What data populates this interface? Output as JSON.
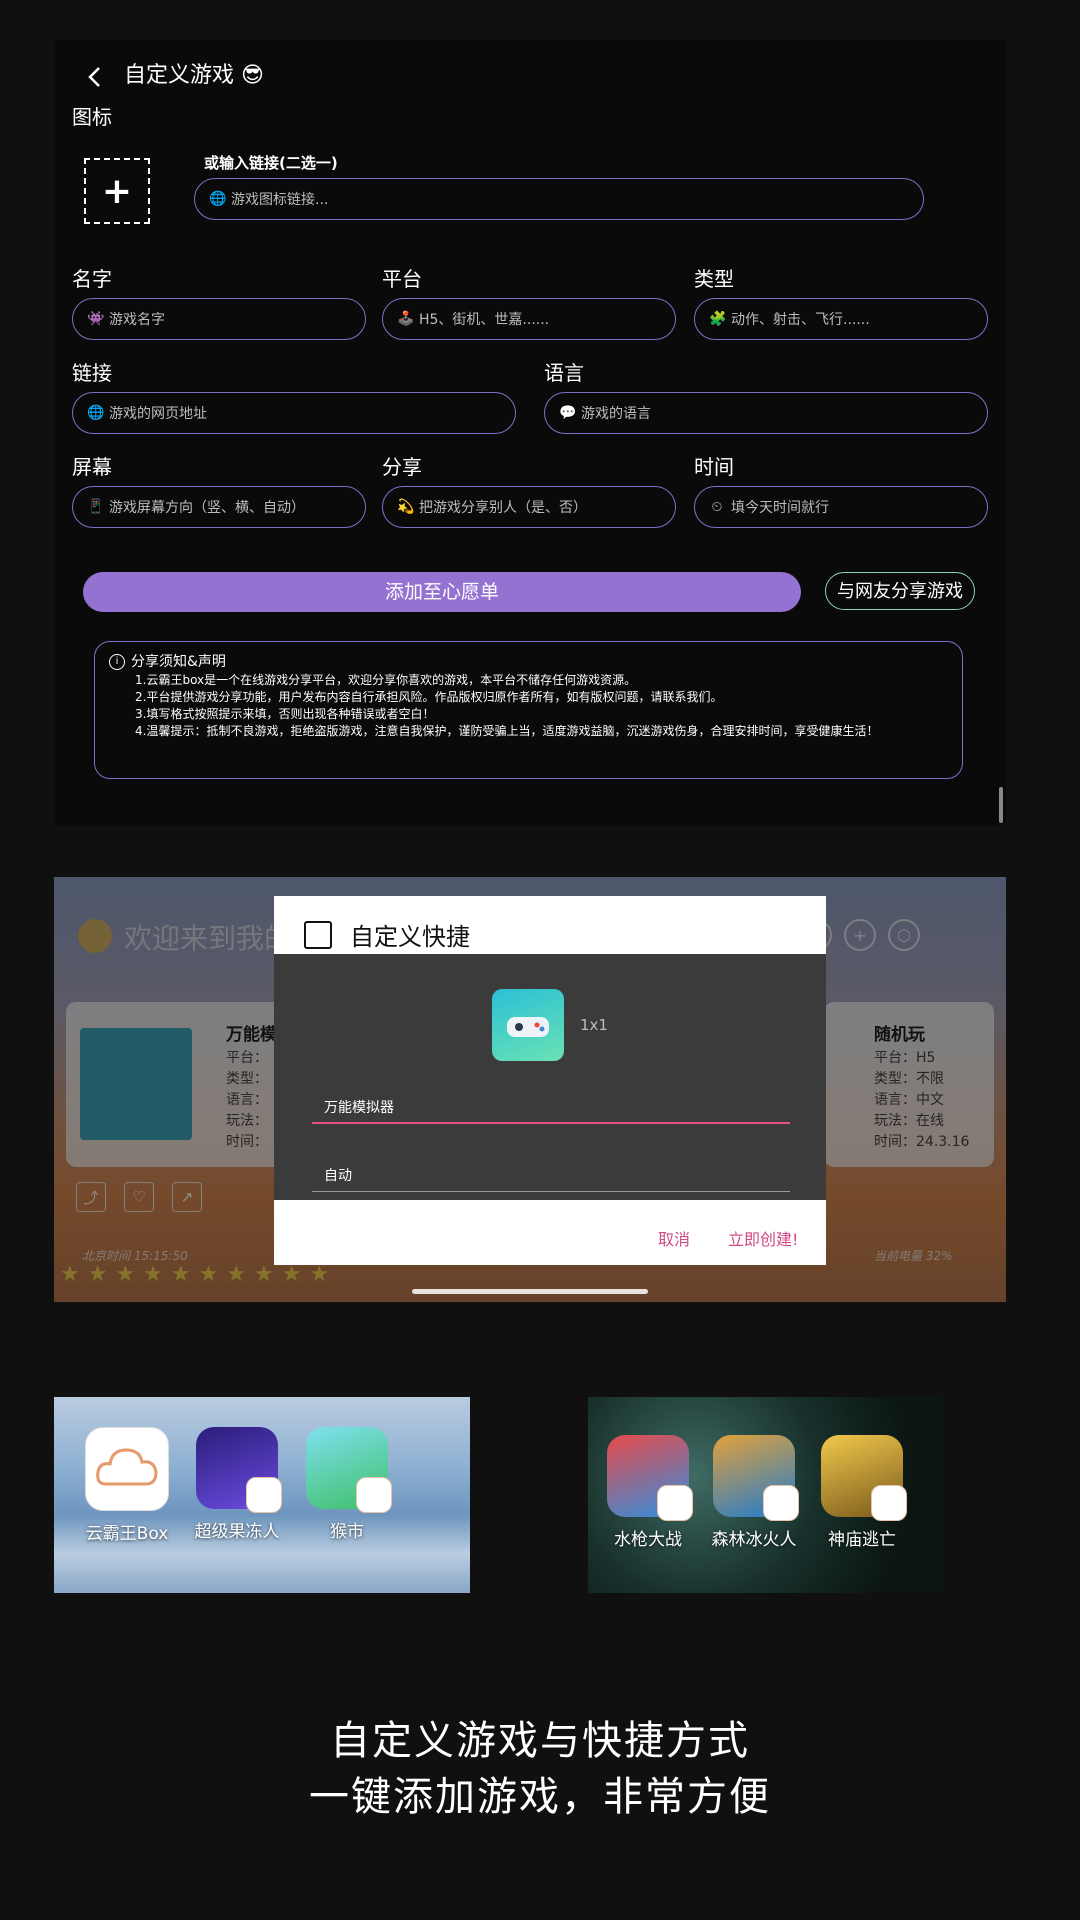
{
  "form": {
    "title": "自定义游戏 😎",
    "icon_label": "图标",
    "link_or_label": "或输入链接(二选一)",
    "icon_link_placeholder": "游戏图标链接...",
    "fields": {
      "name": {
        "label": "名字",
        "placeholder": "游戏名字",
        "icon": "👾"
      },
      "platform": {
        "label": "平台",
        "placeholder": "H5、街机、世嘉......",
        "icon": "🕹️"
      },
      "type": {
        "label": "类型",
        "placeholder": "动作、射击、飞行......",
        "icon": "🧩"
      },
      "link": {
        "label": "链接",
        "placeholder": "游戏的网页地址",
        "icon": "🌐"
      },
      "language": {
        "label": "语言",
        "placeholder": "游戏的语言",
        "icon": "💬"
      },
      "screen": {
        "label": "屏幕",
        "placeholder": "游戏屏幕方向（竖、横、自动）",
        "icon": "📱"
      },
      "share": {
        "label": "分享",
        "placeholder": "把游戏分享别人（是、否）",
        "icon": "💫"
      },
      "time": {
        "label": "时间",
        "placeholder": "填今天时间就行",
        "icon": "⏲"
      }
    },
    "add_wishlist": "添加至心愿单",
    "share_with_friends": "与网友分享游戏",
    "notice": {
      "title": "分享须知&声明",
      "lines": [
        "1.云霸王box是一个在线游戏分享平台，欢迎分享你喜欢的游戏，本平台不储存任何游戏资源。",
        "2.平台提供游戏分享功能，用户发布内容自行承担风险。作品版权归原作者所有，如有版权问题，请联系我们。",
        "3.填写格式按照提示来填，否则出现各种错误或者空白！",
        "4.温馨提示：抵制不良游戏，拒绝盗版游戏，注意自我保护，谨防受骗上当，适度游戏益脑，沉迷游戏伤身，合理安排时间，享受健康生活！"
      ]
    }
  },
  "launcher": {
    "welcome": "欢迎来到我的",
    "left_card": {
      "title": "万能模",
      "lines": [
        "平台：",
        "类型：",
        "语言：",
        "玩法：",
        "时间："
      ]
    },
    "right_card": {
      "title": "随机玩",
      "lines": [
        "平台：H5",
        "类型：不限",
        "语言：中文",
        "玩法：在线",
        "时间：24.3.16"
      ]
    },
    "clock": "北京时间 15:15:50",
    "battery": "当前电量 32%",
    "dialog": {
      "title": "自定义快捷",
      "size": "1x1",
      "name_value": "万能模拟器",
      "mode_value": "自动",
      "cancel": "取消",
      "create": "立即创建!"
    }
  },
  "home_left": {
    "apps": [
      {
        "name": "云霸王Box",
        "color": "#ffffff"
      },
      {
        "name": "超级果冻人",
        "color": "#4a3aa8"
      },
      {
        "name": "猴市",
        "color": "#5ed06a"
      }
    ]
  },
  "home_right": {
    "apps": [
      {
        "name": "水枪大战",
        "color": "#2f8fe0"
      },
      {
        "name": "森林冰火人",
        "color": "#1e7bd0"
      },
      {
        "name": "神庙逃亡",
        "color": "#e3b23a"
      }
    ]
  },
  "caption": {
    "line1": "自定义游戏与快捷方式",
    "line2": "一键添加游戏，非常方便"
  }
}
